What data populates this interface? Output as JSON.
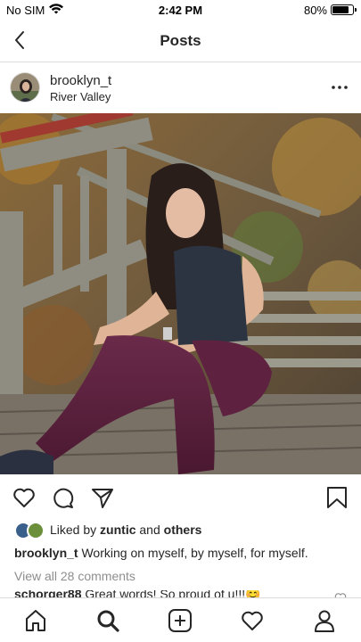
{
  "status_bar": {
    "carrier": "No SIM",
    "time": "2:42 PM",
    "battery": "80%",
    "battery_level": 0.8
  },
  "header": {
    "title": "Posts",
    "back_icon": "chevron-left-icon"
  },
  "post": {
    "username": "brooklyn_t",
    "location": "River Valley",
    "more_icon": "more-horizontal-icon",
    "liked_by_prefix": "Liked by ",
    "liked_by_user": "zuntic",
    "liked_by_and": " and ",
    "liked_by_others": "others",
    "caption_user": "brooklyn_t",
    "caption_text": " Working on myself, by myself, for myself.",
    "view_comments": "View all 28 comments",
    "comment_user": "schorger88",
    "comment_text": " Great words! So proud of u!!!😊"
  },
  "actions": {
    "icons": [
      "heart-icon",
      "comment-icon",
      "share-icon",
      "bookmark-icon"
    ]
  },
  "tabbar": {
    "icons": [
      "home-icon",
      "search-icon",
      "add-icon",
      "activity-heart-icon",
      "profile-icon"
    ]
  },
  "colors": {
    "text": "#262626",
    "muted": "#8e8e8e",
    "divider": "#dbdbdb"
  }
}
